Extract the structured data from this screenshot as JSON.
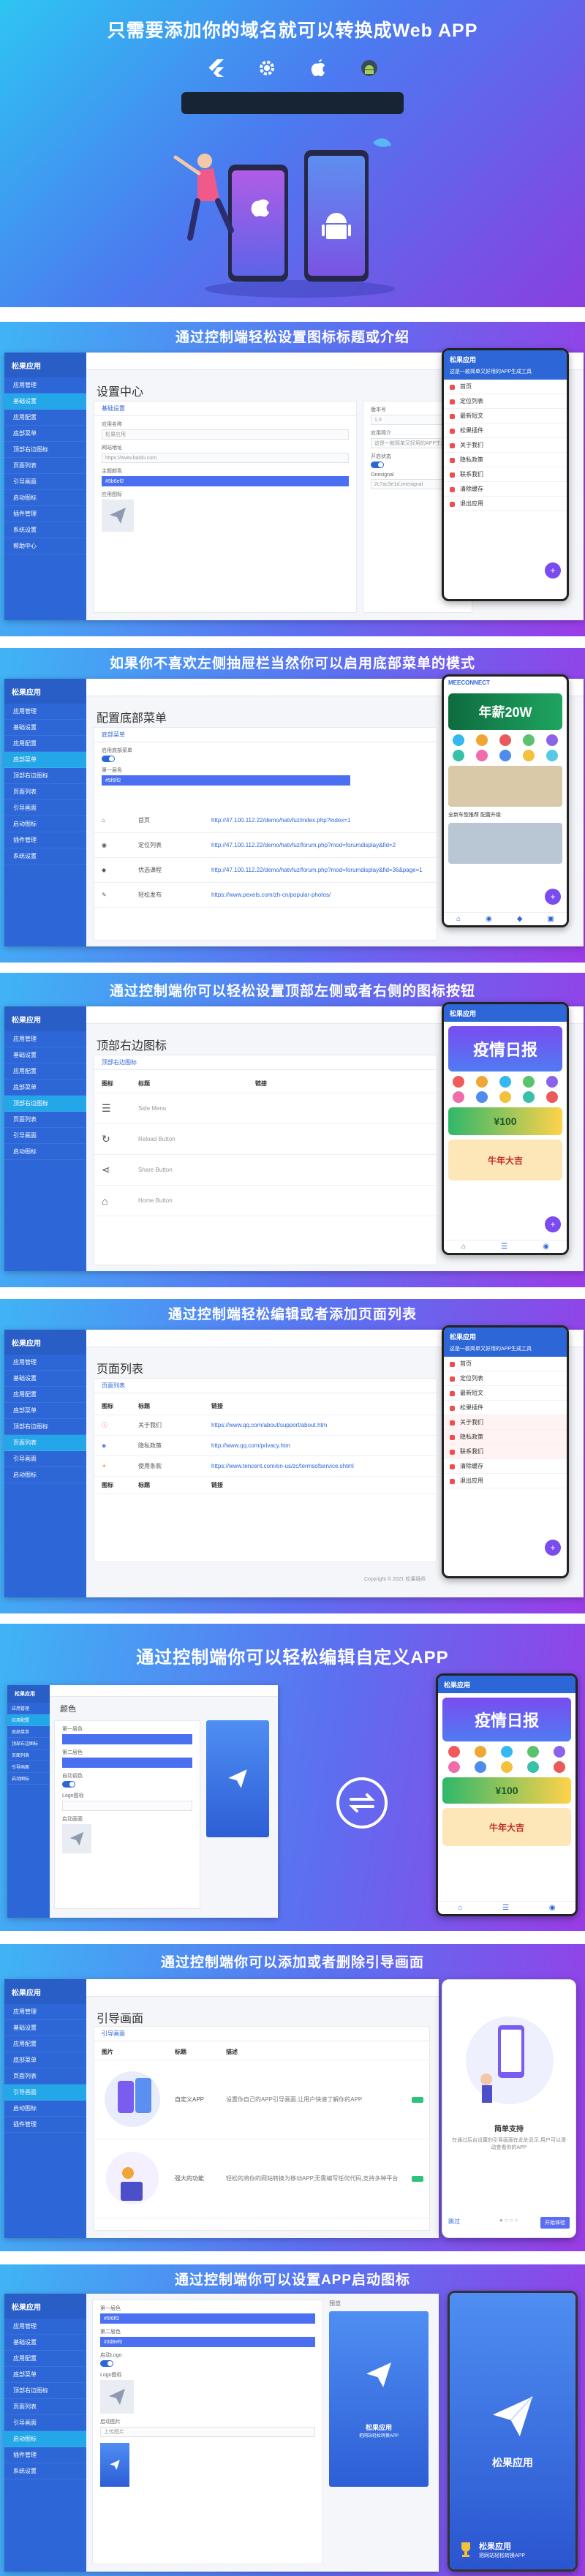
{
  "hero": {
    "title": "只需要添加你的域名就可以转换成Web APP"
  },
  "banners": {
    "b1": "通过控制端轻松设置图标标题或介绍",
    "b2": "如果你不喜欢左侧抽屉栏当然你可以启用底部菜单的模式",
    "b3": "通过控制端你可以轻松设置顶部左侧或者右侧的图标按钮",
    "b4": "通过控制端轻松编辑或者添加页面列表",
    "b5": "通过控制端你可以轻松编辑自定义APP",
    "b6": "通过控制端你可以添加或者删除引导画面",
    "b7": "通过控制端你可以设置APP启动图标"
  },
  "app": {
    "name": "松果应用",
    "slogan": "把网站轻松转换APP",
    "subtitle": "这是一款简单又好用的APP生成工具"
  },
  "sidebar": {
    "items": [
      "应用管理",
      "基础设置",
      "应用配置",
      "底部菜单",
      "顶部右边图标",
      "页面列表",
      "引导画面",
      "启动图标",
      "插件管理",
      "系统设置",
      "帮助中心"
    ]
  },
  "s1": {
    "page_title": "设置中心",
    "tab": "基础设置",
    "labels": [
      "应用名称",
      "版本号",
      "网站地址",
      "主题颜色",
      "应用图标",
      "应用简介",
      "开启状态",
      "Onesignal"
    ],
    "values": [
      "松果应用",
      "1.0",
      "https://www.baidu.com",
      "#5b6ef2",
      "这是一款简单又好用的APP生成工具",
      "2c7ac3e1d.onesignal"
    ],
    "menu": [
      "首页",
      "定位列表",
      "最新短文",
      "松果插件",
      "关于我们",
      "隐私政策",
      "联系我们",
      "清除缓存",
      "退出应用"
    ]
  },
  "s2": {
    "page_title": "配置底部菜单",
    "tab": "底部菜单",
    "labels": [
      "启用底部菜单",
      "第一层色"
    ],
    "color_value": "#5f6ff2",
    "rows": [
      {
        "title": "首页",
        "url": "http://47.100.112.22/demo/hatvfuz/index.php?index=1"
      },
      {
        "title": "定位列表",
        "url": "http://47.100.112.22/demo/hatvfuz/forum.php?mod=forumdisplay&fid=2"
      },
      {
        "title": "优选课程",
        "url": "http://47.100.112.22/demo/hatvfuz/forum.php?mod=forumdisplay&fid=36&page=1"
      },
      {
        "title": "轻松发布",
        "url": "https://www.pexels.com/zh-cn/popular-photos/"
      }
    ],
    "promo": "年薪20W",
    "promo_sub": "MEECONNECT",
    "news": "全新车型推荐 配置升级"
  },
  "s3": {
    "page_title": "顶部右边图标",
    "tab": "顶部右边图标",
    "cols": [
      "图标",
      "标题",
      "链接"
    ],
    "rows": [
      "Side Menu",
      "Reload Button",
      "Share Button",
      "Home Button"
    ],
    "poster": "疫情日报",
    "badge": "¥100",
    "coupon": "每券送好礼",
    "ox": "牛年大吉"
  },
  "s4": {
    "page_title": "页面列表",
    "tab": "页面列表",
    "cols": [
      "图标",
      "标题",
      "链接"
    ],
    "rows": [
      {
        "title": "关于我们",
        "url": "https://www.qq.com/about/support/about.htm"
      },
      {
        "title": "隐私政策",
        "url": "http://www.qq.com/privacy.htm"
      },
      {
        "title": "使用条款",
        "url": "https://www.tencent.com/en-us/zc/termsofservice.shtml"
      }
    ],
    "footer": "Copyright © 2021 松果插件"
  },
  "s5": {
    "page_title": "颜色",
    "labels": [
      "第一层色",
      "第二层色",
      "自动调色",
      "Logo图标",
      "启动画面"
    ]
  },
  "s6": {
    "page_title": "引导画面",
    "tab": "引导画面",
    "cols": [
      "图片",
      "标题",
      "描述"
    ],
    "rows": [
      {
        "title": "自定义APP",
        "desc": "设置你自己的APP引导画面,让用户快速了解你的APP"
      },
      {
        "title": "强大的功能",
        "desc": "轻松的将你的网站转换为移动APP,无需编写任何代码,支持多种平台"
      }
    ],
    "guide_title": "简单支持",
    "guide_desc": "在通过后台设置的引导画面在此处显示,用户可以滑动查看你的APP",
    "skip": "跳过",
    "start": "开始体验"
  },
  "s7": {
    "labels": [
      "第一层色",
      "第二层色",
      "启动Logo",
      "Logo图标",
      "启动图片",
      "上传图片"
    ],
    "values": [
      "#5f6ff2",
      "#3d8ef0"
    ],
    "preview": "预览"
  },
  "chart_data": null
}
